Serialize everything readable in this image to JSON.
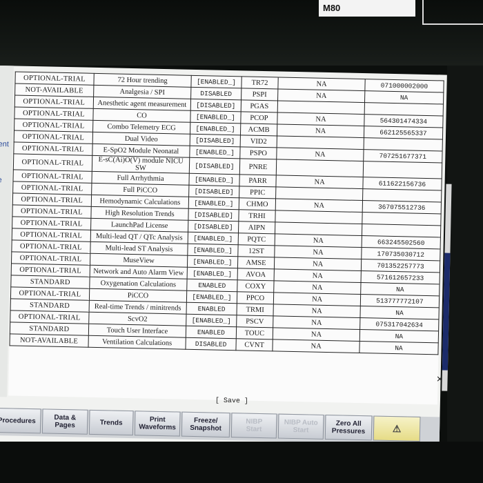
{
  "device": {
    "model": "M80"
  },
  "sidebar": {
    "fragments": [
      "ent",
      "e"
    ]
  },
  "table": {
    "rows": [
      {
        "license": "OPTIONAL-TRIAL",
        "feature": "72 Hour trending",
        "status": "[ENABLED_]",
        "code": "TR72",
        "na": "NA",
        "key": "071000002000"
      },
      {
        "license": "NOT-AVAILABLE",
        "feature": "Analgesia / SPI",
        "status": "DISABLED",
        "code": "PSPI",
        "na": "NA",
        "key": "NA"
      },
      {
        "license": "OPTIONAL-TRIAL",
        "feature": "Anesthetic agent measurement",
        "status": "[DISABLED]",
        "code": "PGAS",
        "na": "",
        "key": ""
      },
      {
        "license": "OPTIONAL-TRIAL",
        "feature": "CO",
        "status": "[ENABLED_]",
        "code": "PCOP",
        "na": "NA",
        "key": "564301474334"
      },
      {
        "license": "OPTIONAL-TRIAL",
        "feature": "Combo Telemetry ECG",
        "status": "[ENABLED_]",
        "code": "ACMB",
        "na": "NA",
        "key": "662125565337"
      },
      {
        "license": "OPTIONAL-TRIAL",
        "feature": "Dual Video",
        "status": "[DISABLED]",
        "code": "VID2",
        "na": "",
        "key": ""
      },
      {
        "license": "OPTIONAL-TRIAL",
        "feature": "E-SpO2 Module Neonatal",
        "status": "[ENABLED_]",
        "code": "PSPO",
        "na": "NA",
        "key": "707251677371"
      },
      {
        "license": "OPTIONAL-TRIAL",
        "feature": "E-sC(Ai)O(V) module NICU SW",
        "status": "[DISABLED]",
        "code": "PNRE",
        "na": "",
        "key": ""
      },
      {
        "license": "OPTIONAL-TRIAL",
        "feature": "Full Arrhythmia",
        "status": "[ENABLED_]",
        "code": "PARR",
        "na": "NA",
        "key": "611622156736"
      },
      {
        "license": "OPTIONAL-TRIAL",
        "feature": "Full PiCCO",
        "status": "[DISABLED]",
        "code": "PPIC",
        "na": "",
        "key": ""
      },
      {
        "license": "OPTIONAL-TRIAL",
        "feature": "Hemodynamic Calculations",
        "status": "[ENABLED_]",
        "code": "CHMO",
        "na": "NA",
        "key": "367075512736"
      },
      {
        "license": "OPTIONAL-TRIAL",
        "feature": "High Resolution Trends",
        "status": "[DISABLED]",
        "code": "TRHI",
        "na": "",
        "key": ""
      },
      {
        "license": "OPTIONAL-TRIAL",
        "feature": "LaunchPad License",
        "status": "[DISABLED]",
        "code": "AIPN",
        "na": "",
        "key": ""
      },
      {
        "license": "OPTIONAL-TRIAL",
        "feature": "Multi-lead QT / QTc Analysis",
        "status": "[ENABLED_]",
        "code": "PQTC",
        "na": "NA",
        "key": "663245502560"
      },
      {
        "license": "OPTIONAL-TRIAL",
        "feature": "Multi-lead ST Analysis",
        "status": "[ENABLED_]",
        "code": "12ST",
        "na": "NA",
        "key": "170735030712"
      },
      {
        "license": "OPTIONAL-TRIAL",
        "feature": "MuseView",
        "status": "[ENABLED_]",
        "code": "AMSE",
        "na": "NA",
        "key": "701352257773"
      },
      {
        "license": "OPTIONAL-TRIAL",
        "feature": "Network and Auto Alarm View",
        "status": "[ENABLED_]",
        "code": "AVOA",
        "na": "NA",
        "key": "571612657233"
      },
      {
        "license": "STANDARD",
        "feature": "Oxygenation Calculations",
        "status": "ENABLED",
        "code": "COXY",
        "na": "NA",
        "key": "NA"
      },
      {
        "license": "OPTIONAL-TRIAL",
        "feature": "PiCCO",
        "status": "[ENABLED_]",
        "code": "PPCO",
        "na": "NA",
        "key": "513777772107"
      },
      {
        "license": "STANDARD",
        "feature": "Real-time Trends / minitrends",
        "status": "ENABLED",
        "code": "TRMI",
        "na": "NA",
        "key": "NA"
      },
      {
        "license": "OPTIONAL-TRIAL",
        "feature": "ScvO2",
        "status": "[ENABLED_]",
        "code": "PSCV",
        "na": "NA",
        "key": "075317042634"
      },
      {
        "license": "STANDARD",
        "feature": "Touch User Interface",
        "status": "ENABLED",
        "code": "TOUC",
        "na": "NA",
        "key": "NA"
      },
      {
        "license": "NOT-AVAILABLE",
        "feature": "Ventilation Calculations",
        "status": "DISABLED",
        "code": "CVNT",
        "na": "NA",
        "key": "NA"
      }
    ]
  },
  "save_label": "[ Save ]",
  "close_glyph": "×",
  "buttons": [
    {
      "label": "Procedures",
      "enabled": true
    },
    {
      "label": "Data &\nPages",
      "enabled": true
    },
    {
      "label": "Trends",
      "enabled": true
    },
    {
      "label": "Print\nWaveforms",
      "enabled": true
    },
    {
      "label": "Freeze/\nSnapshot",
      "enabled": true
    },
    {
      "label": "NIBP\nStart",
      "enabled": false
    },
    {
      "label": "NIBP Auto\nStart",
      "enabled": false
    },
    {
      "label": "Zero All\nPressures",
      "enabled": true
    },
    {
      "label": "⚠",
      "enabled": true
    }
  ]
}
